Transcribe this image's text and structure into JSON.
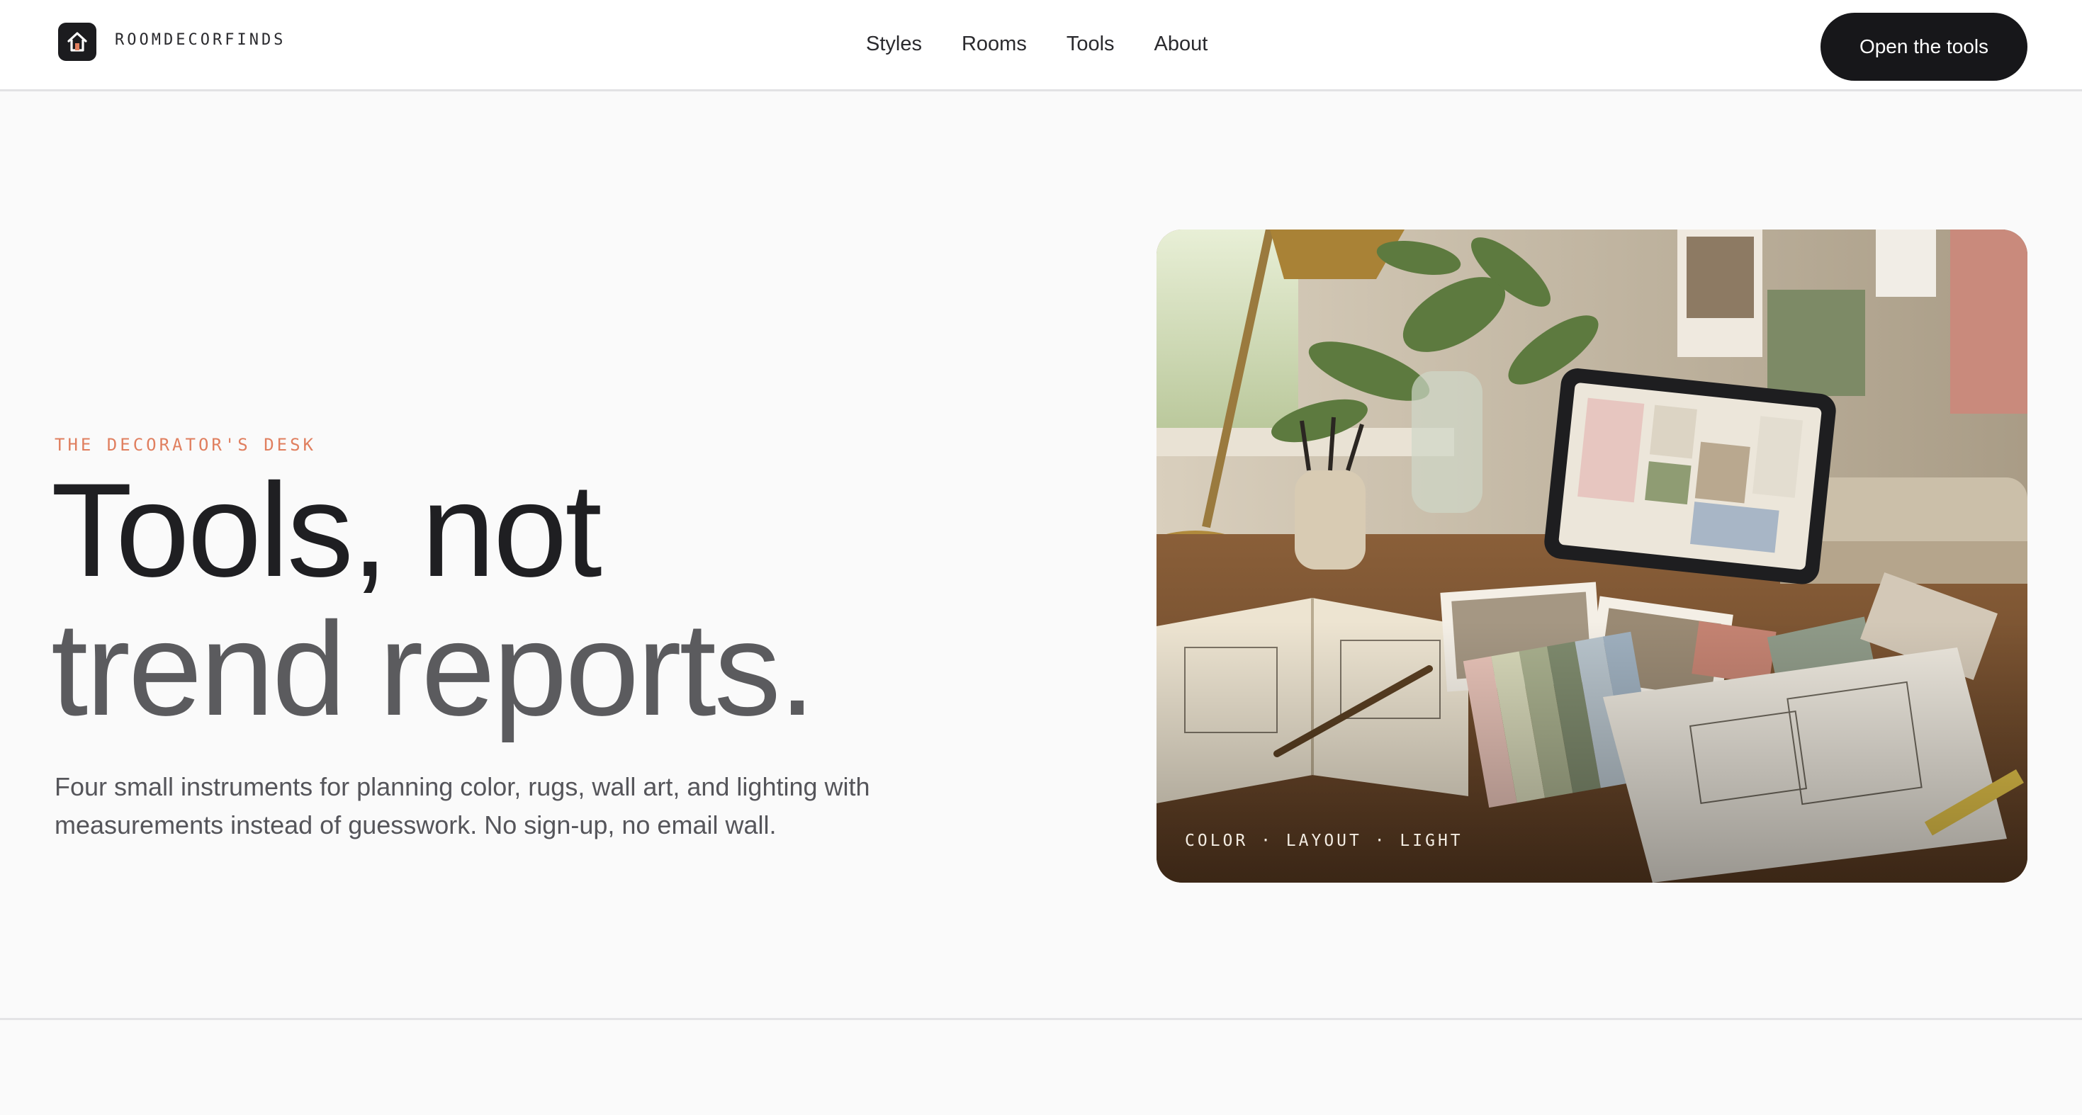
{
  "header": {
    "brand": "ROOMDECORFINDS",
    "nav": [
      "Styles",
      "Rooms",
      "Tools",
      "About"
    ],
    "cta_label": "Open the tools"
  },
  "hero": {
    "eyebrow": "THE DECORATOR'S DESK",
    "headline_line1": "Tools, not",
    "headline_line2": "trend reports.",
    "subtitle": "Four small instruments for planning color, rugs, wall art, and lighting with measurements instead of guesswork. No sign-up, no email wall.",
    "image_caption": "COLOR · LAYOUT · LIGHT"
  },
  "colors": {
    "accent": "#e07f5f",
    "button_bg": "#17171a",
    "headline_dark": "#1f1f22",
    "headline_gray": "#5b5b5e"
  }
}
